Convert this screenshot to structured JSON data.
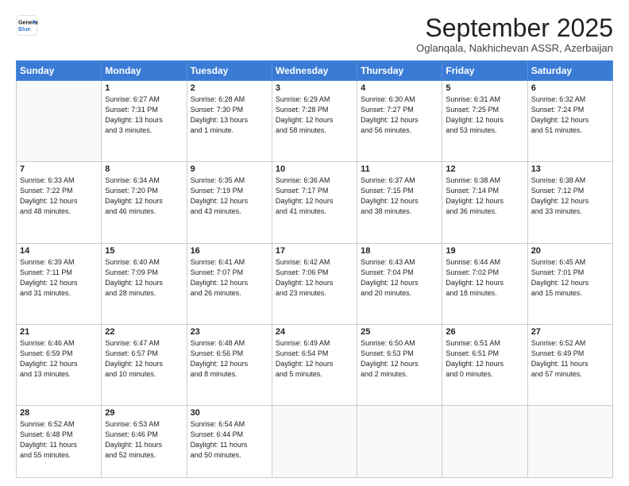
{
  "logo": {
    "line1": "General",
    "line2": "Blue"
  },
  "title": "September 2025",
  "subtitle": "Oglanqala, Nakhichevan ASSR, Azerbaijan",
  "days_header": [
    "Sunday",
    "Monday",
    "Tuesday",
    "Wednesday",
    "Thursday",
    "Friday",
    "Saturday"
  ],
  "weeks": [
    [
      {
        "day": "",
        "content": ""
      },
      {
        "day": "1",
        "content": "Sunrise: 6:27 AM\nSunset: 7:31 PM\nDaylight: 13 hours\nand 3 minutes."
      },
      {
        "day": "2",
        "content": "Sunrise: 6:28 AM\nSunset: 7:30 PM\nDaylight: 13 hours\nand 1 minute."
      },
      {
        "day": "3",
        "content": "Sunrise: 6:29 AM\nSunset: 7:28 PM\nDaylight: 12 hours\nand 58 minutes."
      },
      {
        "day": "4",
        "content": "Sunrise: 6:30 AM\nSunset: 7:27 PM\nDaylight: 12 hours\nand 56 minutes."
      },
      {
        "day": "5",
        "content": "Sunrise: 6:31 AM\nSunset: 7:25 PM\nDaylight: 12 hours\nand 53 minutes."
      },
      {
        "day": "6",
        "content": "Sunrise: 6:32 AM\nSunset: 7:24 PM\nDaylight: 12 hours\nand 51 minutes."
      }
    ],
    [
      {
        "day": "7",
        "content": "Sunrise: 6:33 AM\nSunset: 7:22 PM\nDaylight: 12 hours\nand 48 minutes."
      },
      {
        "day": "8",
        "content": "Sunrise: 6:34 AM\nSunset: 7:20 PM\nDaylight: 12 hours\nand 46 minutes."
      },
      {
        "day": "9",
        "content": "Sunrise: 6:35 AM\nSunset: 7:19 PM\nDaylight: 12 hours\nand 43 minutes."
      },
      {
        "day": "10",
        "content": "Sunrise: 6:36 AM\nSunset: 7:17 PM\nDaylight: 12 hours\nand 41 minutes."
      },
      {
        "day": "11",
        "content": "Sunrise: 6:37 AM\nSunset: 7:15 PM\nDaylight: 12 hours\nand 38 minutes."
      },
      {
        "day": "12",
        "content": "Sunrise: 6:38 AM\nSunset: 7:14 PM\nDaylight: 12 hours\nand 36 minutes."
      },
      {
        "day": "13",
        "content": "Sunrise: 6:38 AM\nSunset: 7:12 PM\nDaylight: 12 hours\nand 33 minutes."
      }
    ],
    [
      {
        "day": "14",
        "content": "Sunrise: 6:39 AM\nSunset: 7:11 PM\nDaylight: 12 hours\nand 31 minutes."
      },
      {
        "day": "15",
        "content": "Sunrise: 6:40 AM\nSunset: 7:09 PM\nDaylight: 12 hours\nand 28 minutes."
      },
      {
        "day": "16",
        "content": "Sunrise: 6:41 AM\nSunset: 7:07 PM\nDaylight: 12 hours\nand 26 minutes."
      },
      {
        "day": "17",
        "content": "Sunrise: 6:42 AM\nSunset: 7:06 PM\nDaylight: 12 hours\nand 23 minutes."
      },
      {
        "day": "18",
        "content": "Sunrise: 6:43 AM\nSunset: 7:04 PM\nDaylight: 12 hours\nand 20 minutes."
      },
      {
        "day": "19",
        "content": "Sunrise: 6:44 AM\nSunset: 7:02 PM\nDaylight: 12 hours\nand 18 minutes."
      },
      {
        "day": "20",
        "content": "Sunrise: 6:45 AM\nSunset: 7:01 PM\nDaylight: 12 hours\nand 15 minutes."
      }
    ],
    [
      {
        "day": "21",
        "content": "Sunrise: 6:46 AM\nSunset: 6:59 PM\nDaylight: 12 hours\nand 13 minutes."
      },
      {
        "day": "22",
        "content": "Sunrise: 6:47 AM\nSunset: 6:57 PM\nDaylight: 12 hours\nand 10 minutes."
      },
      {
        "day": "23",
        "content": "Sunrise: 6:48 AM\nSunset: 6:56 PM\nDaylight: 12 hours\nand 8 minutes."
      },
      {
        "day": "24",
        "content": "Sunrise: 6:49 AM\nSunset: 6:54 PM\nDaylight: 12 hours\nand 5 minutes."
      },
      {
        "day": "25",
        "content": "Sunrise: 6:50 AM\nSunset: 6:53 PM\nDaylight: 12 hours\nand 2 minutes."
      },
      {
        "day": "26",
        "content": "Sunrise: 6:51 AM\nSunset: 6:51 PM\nDaylight: 12 hours\nand 0 minutes."
      },
      {
        "day": "27",
        "content": "Sunrise: 6:52 AM\nSunset: 6:49 PM\nDaylight: 11 hours\nand 57 minutes."
      }
    ],
    [
      {
        "day": "28",
        "content": "Sunrise: 6:52 AM\nSunset: 6:48 PM\nDaylight: 11 hours\nand 55 minutes."
      },
      {
        "day": "29",
        "content": "Sunrise: 6:53 AM\nSunset: 6:46 PM\nDaylight: 11 hours\nand 52 minutes."
      },
      {
        "day": "30",
        "content": "Sunrise: 6:54 AM\nSunset: 6:44 PM\nDaylight: 11 hours\nand 50 minutes."
      },
      {
        "day": "",
        "content": ""
      },
      {
        "day": "",
        "content": ""
      },
      {
        "day": "",
        "content": ""
      },
      {
        "day": "",
        "content": ""
      }
    ]
  ]
}
